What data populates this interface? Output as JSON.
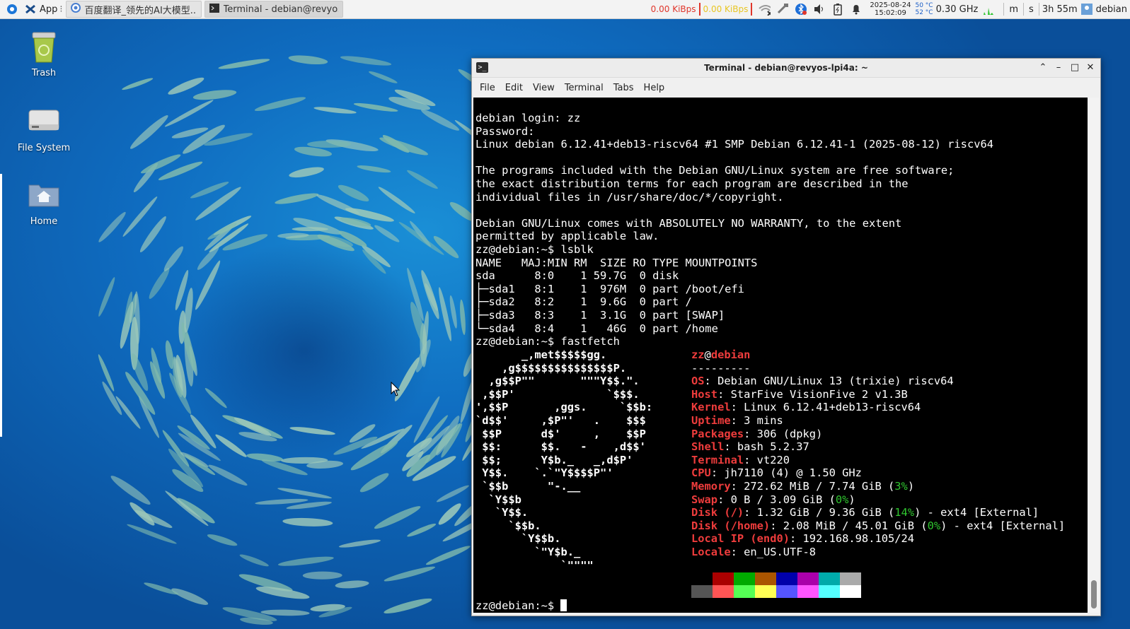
{
  "panel": {
    "apps_label": "App",
    "tasks": [
      {
        "label": "百度翻译_领先的AI大模型...",
        "icon": "chrome-icon"
      },
      {
        "label": "Terminal - debian@revyos...",
        "icon": "terminal-icon"
      }
    ],
    "net_down": "0.00 KiBps",
    "net_up": "0.00 KiBps",
    "date": "2025-08-24",
    "time": "15:02:09",
    "temp1": "50 °C",
    "temp2": "52 °C",
    "cpu_freq": "0.30 GHz",
    "m_label": "m",
    "s_label": "s",
    "battery_time": "3h 55m",
    "user": "debian"
  },
  "desktop": {
    "icons": [
      {
        "label": "Trash",
        "icon": "trash-icon"
      },
      {
        "label": "File System",
        "icon": "drive-icon"
      },
      {
        "label": "Home",
        "icon": "home-folder-icon"
      }
    ]
  },
  "terminal": {
    "title": "Terminal - debian@revyos-lpi4a: ~",
    "menu": [
      "File",
      "Edit",
      "View",
      "Terminal",
      "Tabs",
      "Help"
    ],
    "session_lines": [
      "debian login: zz",
      "Password:",
      "Linux debian 6.12.41+deb13-riscv64 #1 SMP Debian 6.12.41-1 (2025-08-12) riscv64",
      "",
      "The programs included with the Debian GNU/Linux system are free software;",
      "the exact distribution terms for each program are described in the",
      "individual files in /usr/share/doc/*/copyright.",
      "",
      "Debian GNU/Linux comes with ABSOLUTELY NO WARRANTY, to the extent",
      "permitted by applicable law.",
      "zz@debian:~$ lsblk",
      "NAME   MAJ:MIN RM  SIZE RO TYPE MOUNTPOINTS",
      "sda      8:0    1 59.7G  0 disk",
      "├─sda1   8:1    1  976M  0 part /boot/efi",
      "├─sda2   8:2    1  9.6G  0 part /",
      "├─sda3   8:3    1  3.1G  0 part [SWAP]",
      "└─sda4   8:4    1   46G  0 part /home",
      "zz@debian:~$ fastfetch"
    ],
    "logo_lines": [
      "       _,met$$$$$gg.",
      "    ,g$$$$$$$$$$$$$$$P.",
      "  ,g$$P\"\"       \"\"\"Y$$.\".",
      " ,$$P'              `$$$.",
      "',$$P       ,ggs.     `$$b:",
      "`d$$'     ,$P\"'   .    $$$",
      " $$P      d$'     ,    $$P",
      " $$:      $$.   -    ,d$$'",
      " $$;      Y$b._   _,d$P'",
      " Y$$.    `.`\"Y$$$$P\"'",
      " `$$b      \"-.__",
      "  `Y$$b",
      "   `Y$$.",
      "     `$$b.",
      "       `Y$$b.",
      "         `\"Y$b._",
      "             `\"\"\"\""
    ],
    "user": "zz",
    "at": "@",
    "host": "debian",
    "divider": "---------",
    "info": [
      {
        "key": "OS",
        "value": ": Debian GNU/Linux 13 (trixie) riscv64"
      },
      {
        "key": "Host",
        "value": ": StarFive VisionFive 2 v1.3B"
      },
      {
        "key": "Kernel",
        "value": ": Linux 6.12.41+deb13-riscv64"
      },
      {
        "key": "Uptime",
        "value": ": 3 mins"
      },
      {
        "key": "Packages",
        "value": ": 306 (dpkg)"
      },
      {
        "key": "Shell",
        "value": ": bash 5.2.37"
      },
      {
        "key": "Terminal",
        "value": ": vt220"
      },
      {
        "key": "CPU",
        "value": ": jh7110 (4) @ 1.50 GHz"
      },
      {
        "key": "Memory",
        "value": ": 272.62 MiB / 7.74 GiB (",
        "pct": "3%",
        "tail": ")"
      },
      {
        "key": "Swap",
        "value": ": 0 B / 3.09 GiB (",
        "pct": "0%",
        "tail": ")"
      },
      {
        "key": "Disk (/)",
        "value": ": 1.32 GiB / 9.36 GiB (",
        "pct": "14%",
        "tail": ") - ext4 [External]"
      },
      {
        "key": "Disk (/home)",
        "value": ": 2.08 MiB / 45.01 GiB (",
        "pct": "0%",
        "tail": ") - ext4 [External]"
      },
      {
        "key": "Local IP (end0)",
        "value": ": 192.168.98.105/24"
      },
      {
        "key": "Locale",
        "value": ": en_US.UTF-8"
      }
    ],
    "palette_top": [
      "#000000",
      "#aa0000",
      "#00aa00",
      "#aa5500",
      "#0000aa",
      "#aa00aa",
      "#00aaaa",
      "#aaaaaa"
    ],
    "palette_bottom": [
      "#555555",
      "#ff5555",
      "#55ff55",
      "#ffff55",
      "#5555ff",
      "#ff55ff",
      "#55ffff",
      "#ffffff"
    ],
    "prompt": "zz@debian:~$ "
  }
}
